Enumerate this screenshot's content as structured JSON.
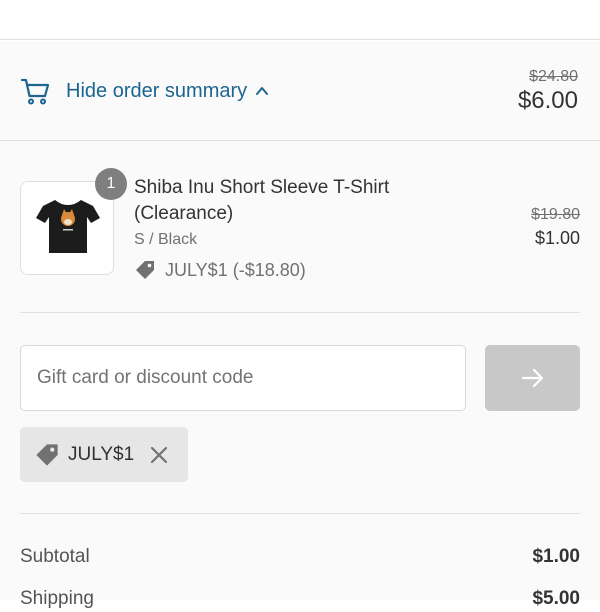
{
  "summary": {
    "toggle_label": "Hide order summary",
    "compare_total": "$24.80",
    "total": "$6.00"
  },
  "line_item": {
    "quantity": "1",
    "title": "Shiba Inu Short Sleeve T-Shirt (Clearance)",
    "variant": "S / Black",
    "discount": "JULY$1 (-$18.80)",
    "compare_price": "$19.80",
    "price": "$1.00"
  },
  "discount_form": {
    "placeholder": "Gift card or discount code",
    "value": ""
  },
  "applied_code": "JULY$1",
  "costs": [
    {
      "label": "Subtotal",
      "value": "$1.00"
    },
    {
      "label": "Shipping",
      "value": "$5.00"
    }
  ],
  "colors": {
    "link": "#1a6691",
    "panel_bg": "#fafafa",
    "badge_bg": "#7f7f7f",
    "button_disabled": "#c8c8c8"
  },
  "icons": [
    "cart-icon",
    "chevron-up-icon",
    "tag-icon",
    "arrow-right-icon",
    "close-icon"
  ]
}
